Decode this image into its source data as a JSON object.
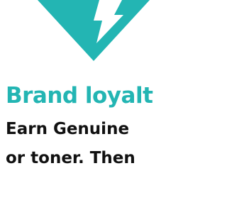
{
  "colors": {
    "accent": "#23b5b3",
    "text": "#111111",
    "background": "#ffffff"
  },
  "logo": {
    "icon": "download-arrow-icon"
  },
  "content": {
    "headline": "Brand loyalt",
    "body_lines": [
      "Earn Genuine",
      "or toner. Then"
    ]
  }
}
